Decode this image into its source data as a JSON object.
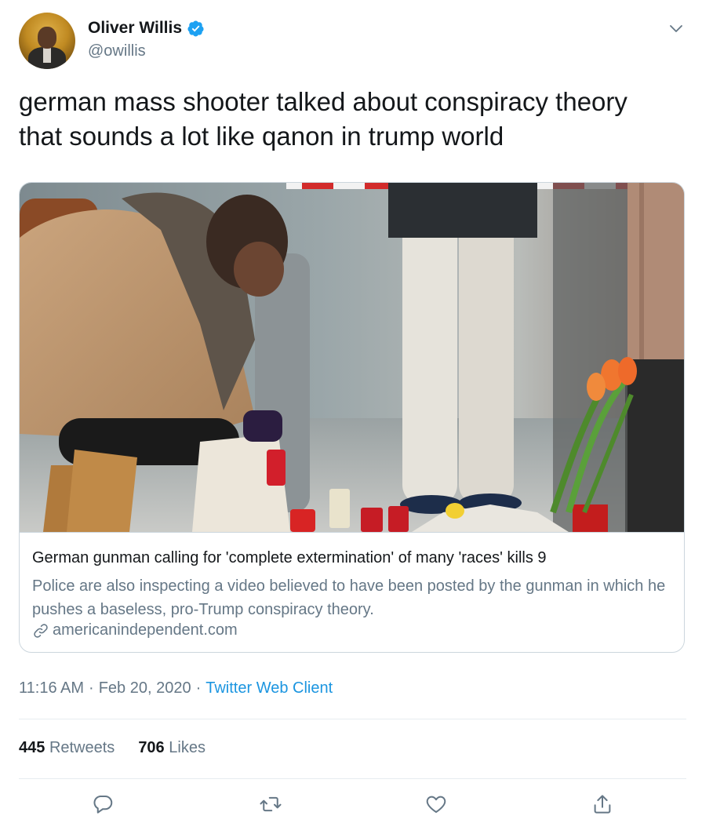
{
  "author": {
    "name": "Oliver Willis",
    "handle": "@owillis",
    "verified": true
  },
  "icons": {
    "verified": "verified-badge-icon",
    "menu": "chevron-down-icon",
    "link": "link-icon",
    "reply": "reply-icon",
    "retweet": "retweet-icon",
    "like": "heart-icon",
    "share": "share-icon"
  },
  "tweet": {
    "text_line1": "german mass shooter talked about conspiracy theory",
    "text_line2": "that sounds a lot like qanon in trump world"
  },
  "card": {
    "title": "German gunman calling for 'complete extermination' of many 'races' kills 9",
    "description": "Police are also inspecting a video believed to have been posted by the gunman in which he pushes a baseless, pro-Trump conspiracy theory.",
    "domain": "americanindependent.com"
  },
  "meta": {
    "time": "11:16 AM",
    "separator": "·",
    "date": "Feb 20, 2020",
    "client": "Twitter Web Client"
  },
  "stats": {
    "retweets_count": "445",
    "retweets_label": "Retweets",
    "likes_count": "706",
    "likes_label": "Likes"
  },
  "colors": {
    "text": "#14171a",
    "secondary": "#657786",
    "link": "#1b95e0",
    "verified": "#1da1f2",
    "border": "#ccd6dd",
    "divider": "#e6ecf0"
  }
}
